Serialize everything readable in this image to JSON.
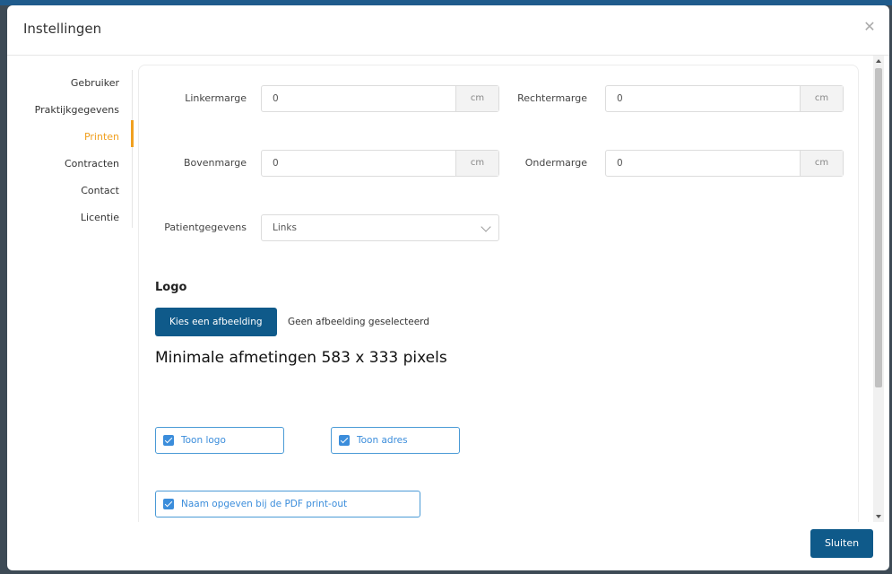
{
  "modal": {
    "title": "Instellingen",
    "close_icon": "close-icon",
    "footer_button": "Sluiten"
  },
  "sidebar": {
    "items": [
      {
        "label": "Gebruiker",
        "active": false
      },
      {
        "label": "Praktijkgegevens",
        "active": false
      },
      {
        "label": "Printen",
        "active": true
      },
      {
        "label": "Contracten",
        "active": false
      },
      {
        "label": "Contact",
        "active": false
      },
      {
        "label": "Licentie",
        "active": false
      }
    ]
  },
  "print": {
    "left_margin": {
      "label": "Linkermarge",
      "value": "0",
      "unit": "cm"
    },
    "right_margin": {
      "label": "Rechtermarge",
      "value": "0",
      "unit": "cm"
    },
    "top_margin": {
      "label": "Bovenmarge",
      "value": "0",
      "unit": "cm"
    },
    "bottom_margin": {
      "label": "Ondermarge",
      "value": "0",
      "unit": "cm"
    },
    "patient_data": {
      "label": "Patientgegevens",
      "selected": "Links"
    },
    "logo": {
      "heading": "Logo",
      "choose_button": "Kies een afbeelding",
      "file_status": "Geen afbeelding geselecteerd",
      "dimensions_note": "Minimale afmetingen 583 x 333 pixels"
    },
    "checkboxes": {
      "show_logo": {
        "label": "Toon logo",
        "checked": true
      },
      "show_address": {
        "label": "Toon adres",
        "checked": true
      },
      "name_pdf": {
        "label": "Naam opgeven bij de PDF print-out",
        "checked": true
      }
    }
  },
  "colors": {
    "accent": "#f0a020",
    "primary": "#0f5a8a",
    "checkbox": "#3b8ddb"
  }
}
